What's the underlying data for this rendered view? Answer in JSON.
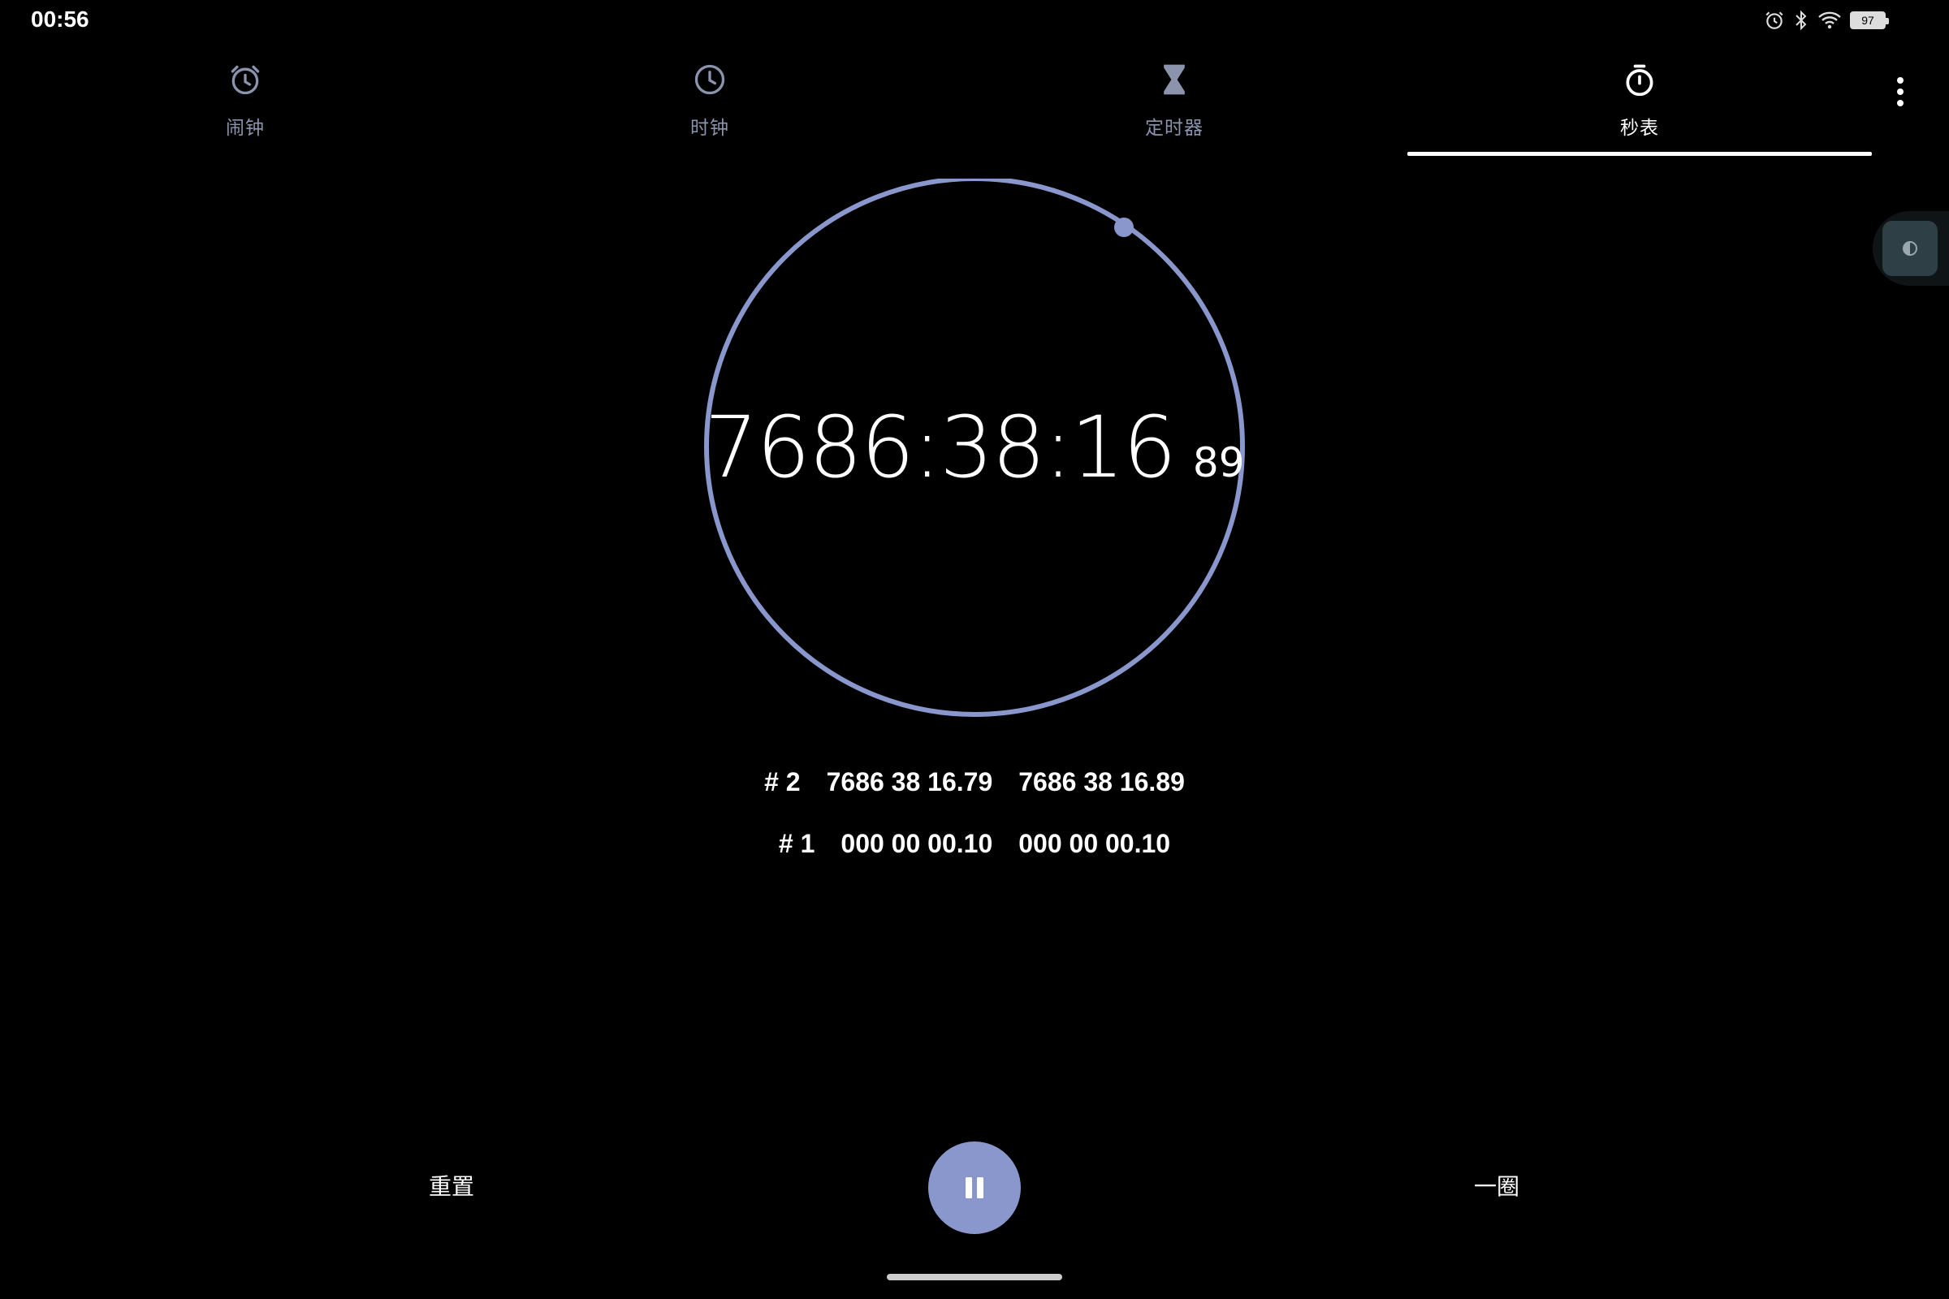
{
  "status_bar": {
    "time": "00:56",
    "battery_level": "97",
    "icons": [
      "alarm-icon",
      "bluetooth-icon",
      "wifi-icon",
      "battery-icon"
    ]
  },
  "tabs": [
    {
      "label": "闹钟",
      "icon": "alarm-icon",
      "active": false
    },
    {
      "label": "时钟",
      "icon": "clock-icon",
      "active": false
    },
    {
      "label": "定时器",
      "icon": "hourglass-icon",
      "active": false
    },
    {
      "label": "秒表",
      "icon": "stopwatch-icon",
      "active": true
    }
  ],
  "stopwatch": {
    "elapsed_main": "7686:38:16",
    "elapsed_hundredths": "89",
    "ring_color": "#8a97cc"
  },
  "laps": [
    {
      "number": "# 2",
      "lap_time": "7686 38 16.79",
      "total_time": "7686 38 16.89"
    },
    {
      "number": "# 1",
      "lap_time": "000 00 00.10",
      "total_time": "000 00 00.10"
    }
  ],
  "controls": {
    "reset_label": "重置",
    "lap_label": "一圈",
    "pause_icon": "pause-icon"
  },
  "colors": {
    "accent": "#8a97cc",
    "inactive_tab": "#8b93ad",
    "background": "#000000"
  }
}
